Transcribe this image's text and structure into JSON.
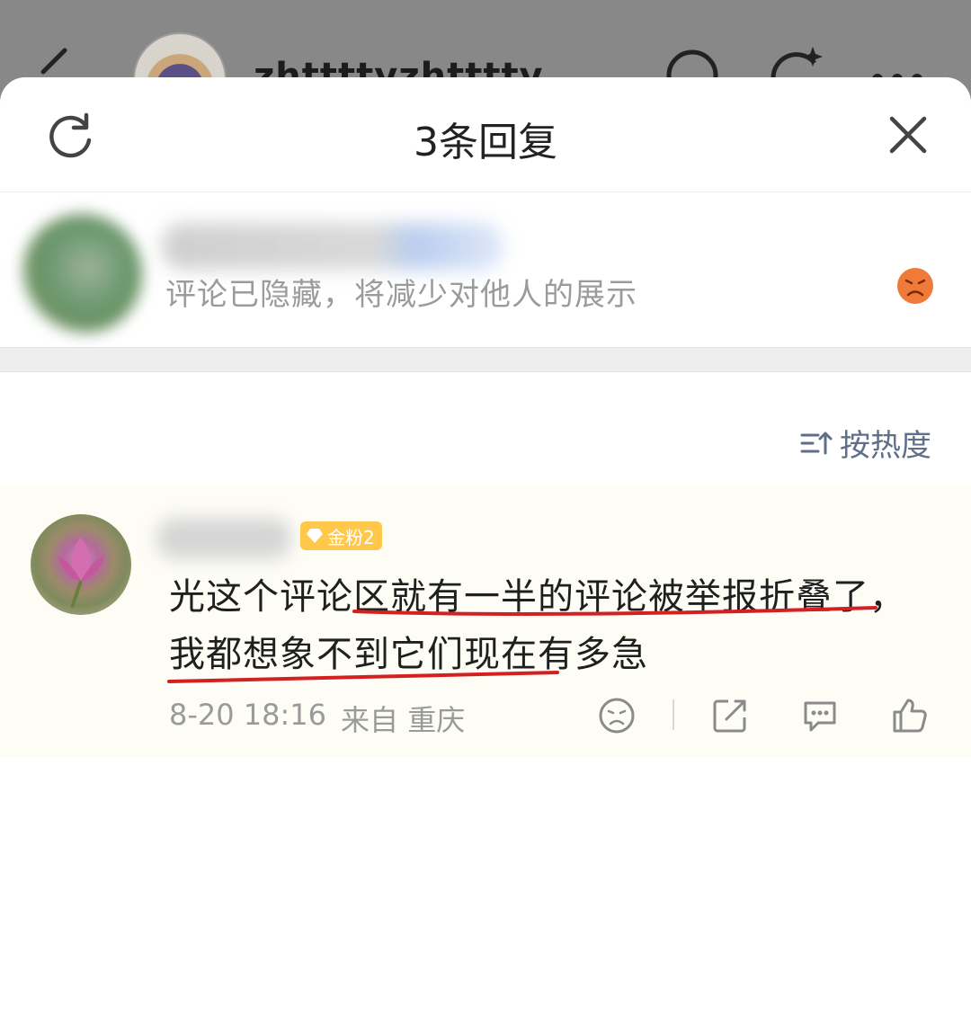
{
  "background": {
    "username": "zhttttyzhtttty"
  },
  "sheet": {
    "title": "3条回复"
  },
  "hidden_comment": {
    "text": "评论已隐藏，将减少对他人的展示"
  },
  "sort": {
    "label": "按热度"
  },
  "comment": {
    "badge": "金粉2",
    "text": "光这个评论区就有一半的评论被举报折叠了，我都想象不到它们现在有多急",
    "date": "8-20 18:16",
    "location": "来自 重庆"
  },
  "colors": {
    "accent_orange": "#f07a3a",
    "badge_gold": "#ffc84a",
    "underline_red": "#d42020",
    "sort_text": "#5f6f8a"
  },
  "icons": [
    "back-icon",
    "refresh-icon",
    "close-icon",
    "sad-face-icon",
    "sort-icon",
    "share-icon",
    "comment-icon",
    "like-icon",
    "emoji-icon"
  ]
}
